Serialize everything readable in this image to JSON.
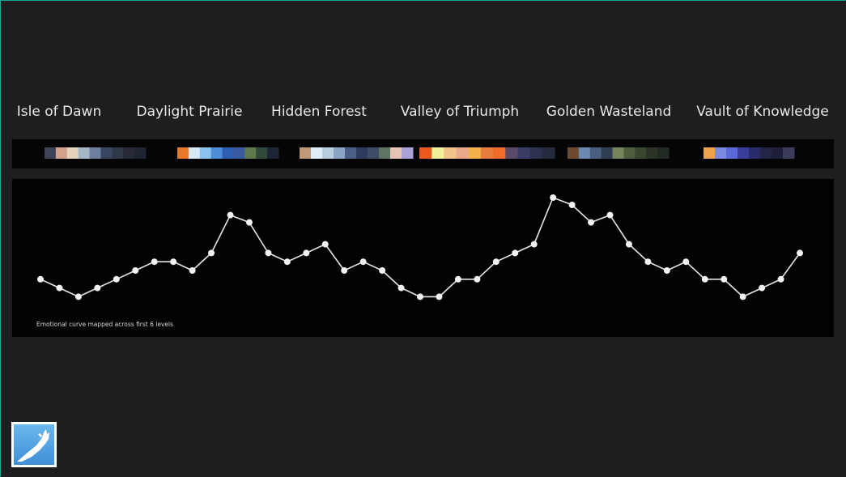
{
  "levels": [
    {
      "name": "Isle of Dawn",
      "palette": [
        "#3d4458",
        "#d2a38a",
        "#e5d4bb",
        "#a4b6c8",
        "#6d7f9e",
        "#3a4560",
        "#2f3848",
        "#252a36",
        "#1f2530"
      ]
    },
    {
      "name": "Daylight Prairie",
      "palette": [
        "#e6782a",
        "#d7e8f6",
        "#8cc2ee",
        "#4d8ed8",
        "#2e5eaf",
        "#3a5aa0",
        "#5e7a4a",
        "#2f4a3a",
        "#1c2533"
      ]
    },
    {
      "name": "Hidden Forest",
      "palette": [
        "#c09a78",
        "#e2eef7",
        "#b8cfe0",
        "#8aa4c4",
        "#4a5f86",
        "#2d3c5e",
        "#404b66",
        "#5e7464",
        "#e7c3b6",
        "#a9a2d6"
      ]
    },
    {
      "name": "Valley of Triumph",
      "palette": [
        "#e85b1c",
        "#f4ef9a",
        "#f2c38c",
        "#e8aa8a",
        "#f5b24c",
        "#e87d3e",
        "#ef6d29",
        "#5a4a68",
        "#3a3e66",
        "#2c3150",
        "#262b40"
      ]
    },
    {
      "name": "Golden Wasteland",
      "palette": [
        "#6e4a2e",
        "#6b8ab0",
        "#4a5e80",
        "#2f3e52",
        "#76845a",
        "#4e5e3e",
        "#38452f",
        "#2a3326",
        "#202a22"
      ]
    },
    {
      "name": "Vault of Knowledge",
      "palette": [
        "#f0a050",
        "#7a8ae0",
        "#5a6ad8",
        "#3a3e9a",
        "#2a2c6a",
        "#222448",
        "#1d1f38",
        "#3a3c5a"
      ]
    }
  ],
  "chart_data": {
    "type": "line",
    "caption": "Emotional curve mapped across first 6 levels",
    "ylim": [
      0,
      10
    ],
    "grid": false,
    "series": [
      {
        "values": [
          3.4,
          2.8,
          2.2,
          2.8,
          3.4,
          4.0,
          4.6,
          4.6,
          4.0,
          5.2,
          7.8,
          7.3,
          5.2,
          4.6,
          5.2,
          5.8,
          4.0,
          4.6,
          4.0,
          2.8,
          2.2,
          2.2,
          3.4,
          3.4,
          4.6,
          5.2,
          5.8,
          9.0,
          8.5,
          7.3,
          7.8,
          5.8,
          4.6,
          4.0,
          4.6,
          3.4,
          3.4,
          2.2,
          2.8,
          3.4,
          5.2
        ]
      }
    ]
  }
}
